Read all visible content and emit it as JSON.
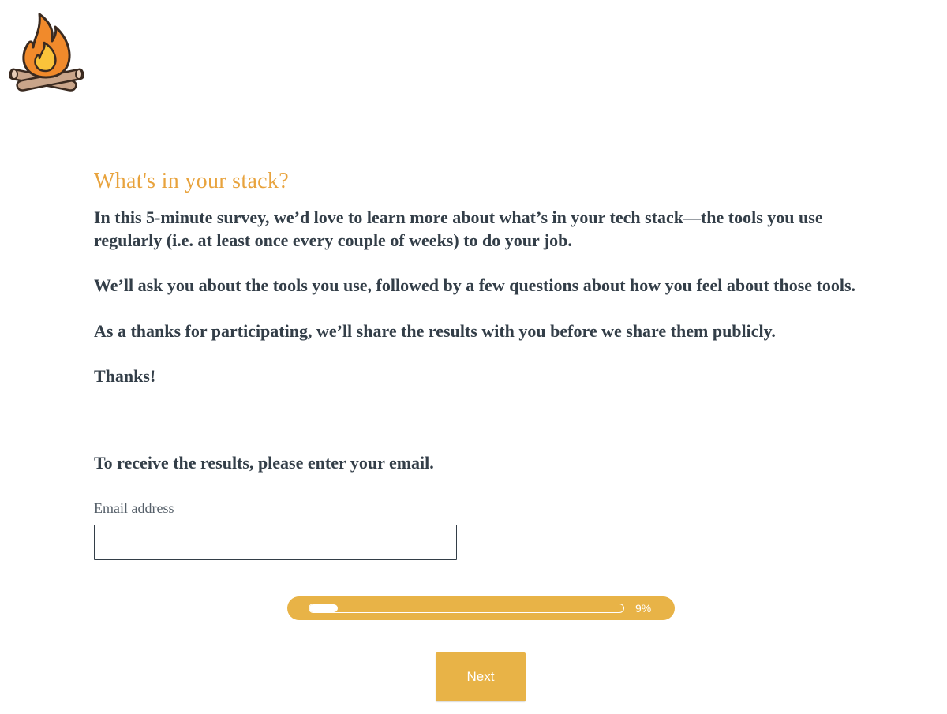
{
  "logo": {
    "icon": "campfire-icon",
    "colors": {
      "flame_outer": "#f18a2b",
      "flame_inner": "#f9c33a",
      "logs": "#c9a58a",
      "outline": "#3a2a20"
    }
  },
  "survey": {
    "title": "What's in your stack?",
    "intro": [
      "In this 5-minute survey, we’d love to learn more about what’s in your tech stack—the tools you use regularly (i.e. at least once every couple of weeks) to do your job.",
      "We’ll ask you about the tools you use, followed by a few questions about how you feel about those tools.",
      "As a thanks for participating, we’ll share the results with you before we share them publicly.",
      "Thanks!"
    ],
    "question": "To receive the results, please enter your email.",
    "email_label": "Email address",
    "email_value": "",
    "email_placeholder": ""
  },
  "progress": {
    "value": 0.09,
    "label": "9%"
  },
  "next_button": {
    "label": "Next"
  },
  "colors": {
    "accent": "#e8b347",
    "title": "#e8a33d",
    "text": "#333e48"
  }
}
